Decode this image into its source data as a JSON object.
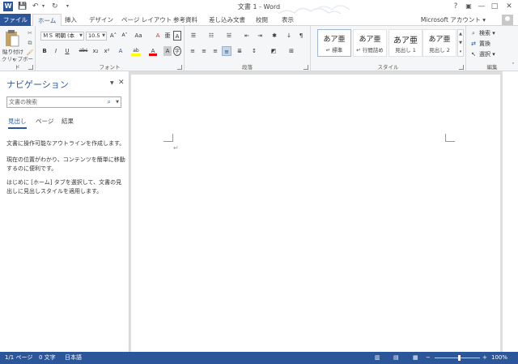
{
  "window": {
    "title": "文書 1 - Word",
    "app_icon": "W"
  },
  "qat": {
    "save_icon": "💾",
    "undo_icon": "↶",
    "redo_icon": "↻",
    "customize_icon": "▾"
  },
  "controls": {
    "help": "?",
    "restore": "▣",
    "minimize": "—",
    "maximize": "□",
    "close": "✕"
  },
  "tabs": [
    {
      "label": "ファイル"
    },
    {
      "label": "ホーム"
    },
    {
      "label": "挿入"
    },
    {
      "label": "デザイン"
    },
    {
      "label": "ページ レイアウト"
    },
    {
      "label": "参考資料"
    },
    {
      "label": "差し込み文書"
    },
    {
      "label": "校閲"
    },
    {
      "label": "表示"
    }
  ],
  "account": "Microsoft アカウント ▾",
  "ribbon": {
    "clipboard": {
      "label": "クリップボード",
      "paste": "貼り付け"
    },
    "font": {
      "label": "フォント",
      "font_name": "ＭＳ 明朝 (本",
      "font_size": "10.5",
      "grow": "A˄",
      "shrink": "A˅",
      "case": "Aa",
      "clear": "A",
      "ruby": "亜",
      "border": "A",
      "bold": "B",
      "italic": "I",
      "underline": "U",
      "strike": "abc",
      "sub": "x₂",
      "sup": "x²",
      "effects": "A",
      "highlight": "ab",
      "color": "A",
      "shade": "A",
      "circle": "字"
    },
    "paragraph": {
      "label": "段落",
      "bullets": "☰",
      "numbering": "☷",
      "multilevel": "☱",
      "decrease": "⇤",
      "increase": "⇥",
      "sort": "✱",
      "marks": "¶",
      "align_left": "≡",
      "center": "≡",
      "align_right": "≡",
      "justify": "≡",
      "distribute": "≣",
      "spacing": "↕",
      "shading": "◩",
      "borders": "⊞"
    },
    "styles": {
      "label": "スタイル",
      "items": [
        {
          "sample": "あア亜",
          "name": "↵ 標準"
        },
        {
          "sample": "あア亜",
          "name": "↵ 行間詰め"
        },
        {
          "sample": "あア亜",
          "name": "見出し 1"
        },
        {
          "sample": "あア亜",
          "name": "見出し 2"
        }
      ]
    },
    "editing": {
      "label": "編集",
      "find": "検索 ▾",
      "replace": "置換",
      "select": "選択 ▾"
    }
  },
  "nav": {
    "title": "ナビゲーション",
    "search_placeholder": "文書の検索",
    "tabs": [
      "見出し",
      "ページ",
      "結果"
    ],
    "p1": "文書に操作可能なアウトラインを作成します。",
    "p2": "現在の位置がわかり、コンテンツを簡単に移動するのに便利です。",
    "p3": "はじめに [ホーム] タブを選択して、文書の見出しに見出しスタイルを適用します。"
  },
  "document": {
    "para_mark": "↵"
  },
  "status": {
    "page": "1/1 ページ",
    "words": "0 文字",
    "language": "日本語",
    "zoom": "100%",
    "zoom_value": 100
  }
}
